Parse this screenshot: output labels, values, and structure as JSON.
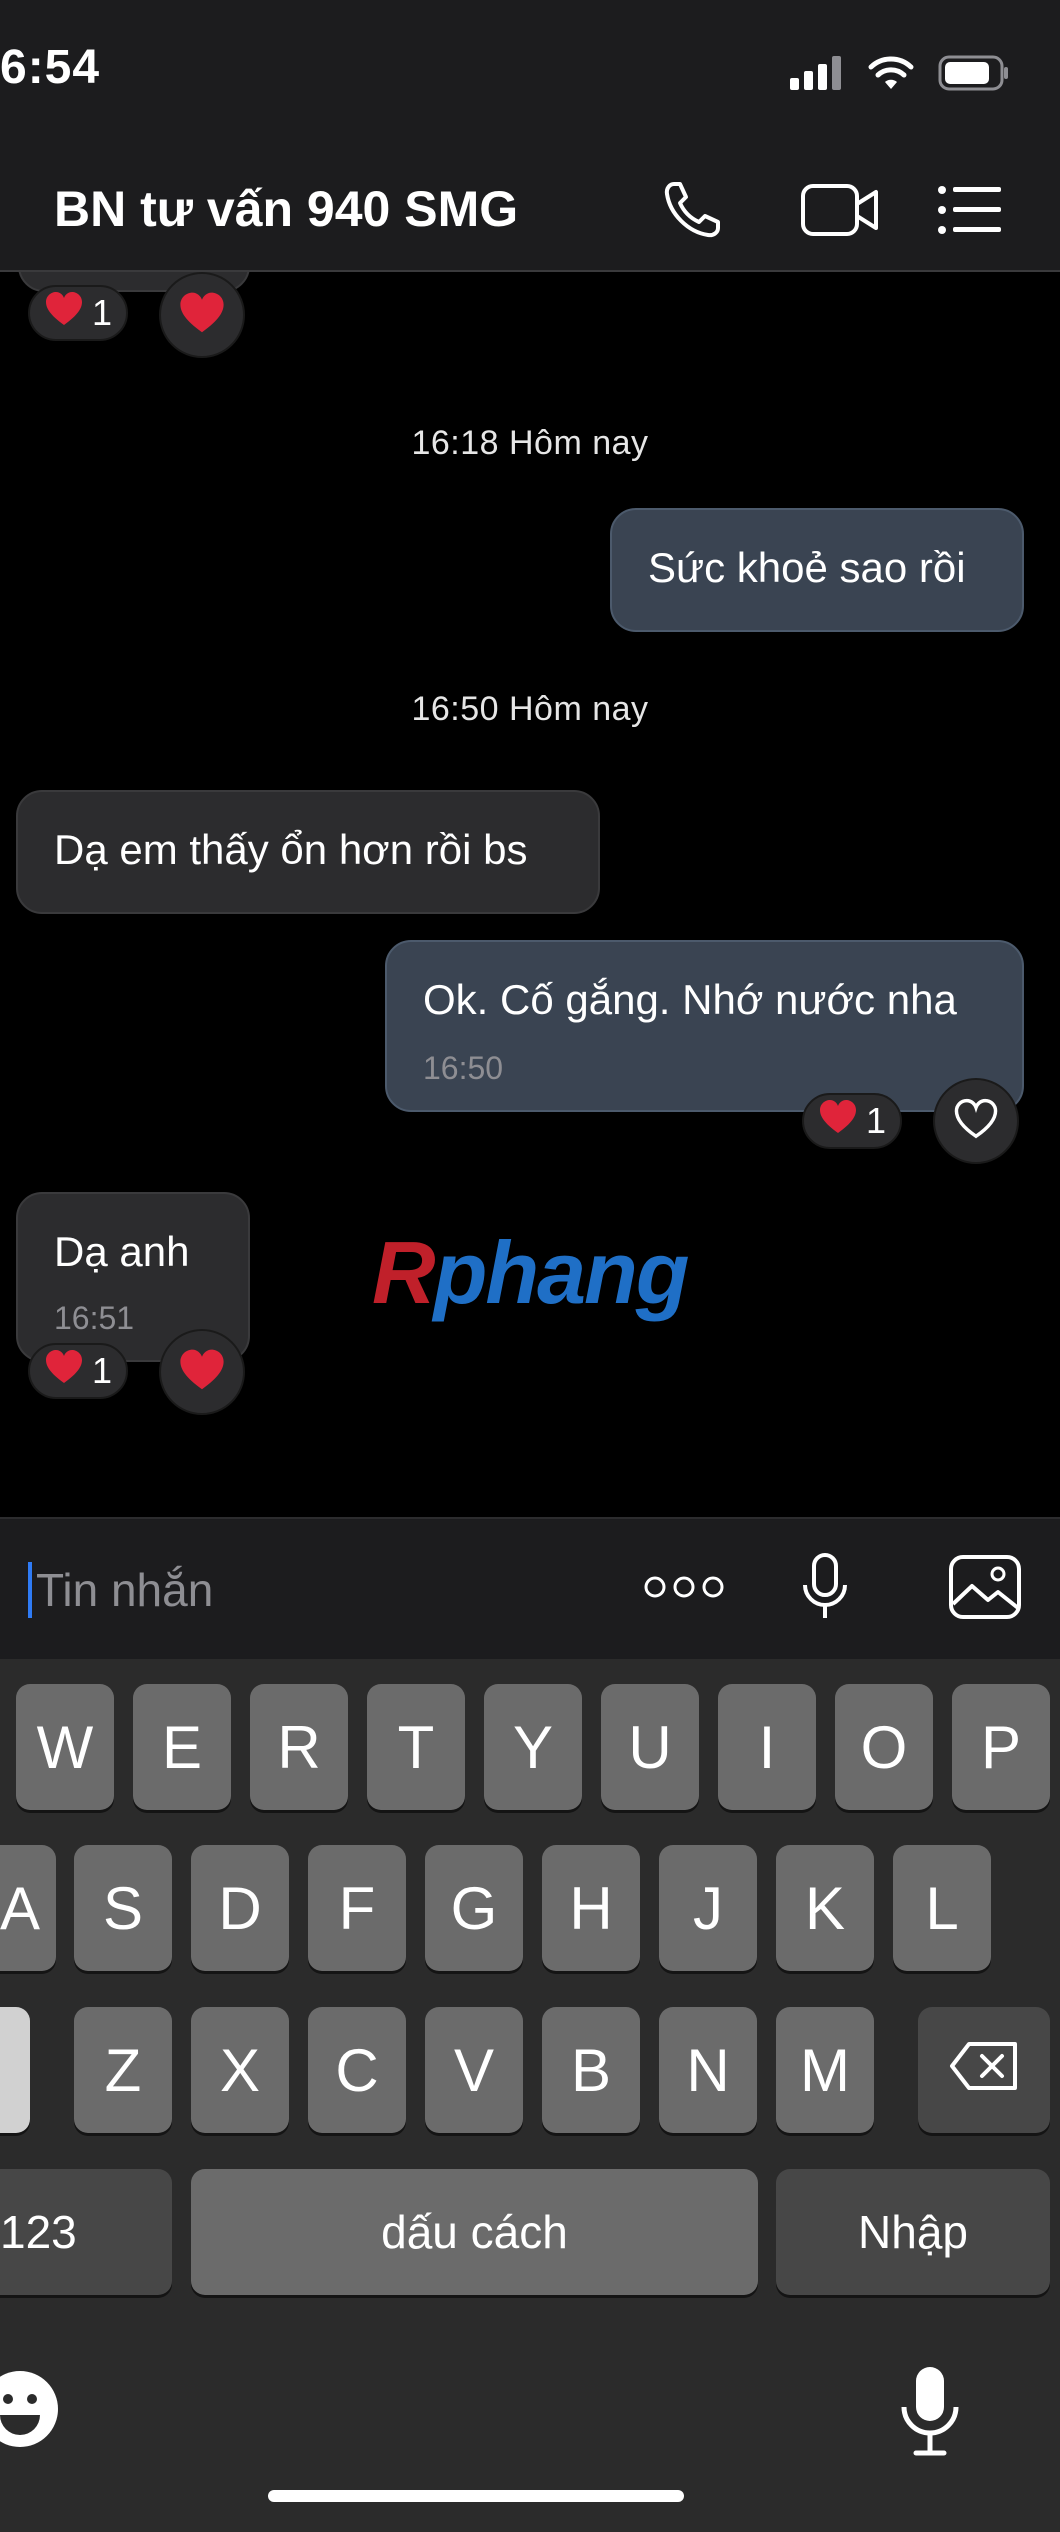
{
  "status_bar": {
    "time": "6:54"
  },
  "header": {
    "title": "BN tư vấn 940 SMG",
    "icons": [
      "phone-icon",
      "video-icon",
      "menu-list-icon"
    ]
  },
  "messages": {
    "top_reaction_count": "1",
    "separator_1": "16:18 Hôm nay",
    "msg_out_1": {
      "text": "Sức khoẻ sao rồi"
    },
    "separator_2": "16:50 Hôm nay",
    "msg_in_1": {
      "text": "Dạ em thấy ổn hơn rồi bs"
    },
    "msg_out_2": {
      "text": "Ok. Cố gắng. Nhớ nước nha",
      "time": "16:50",
      "reaction_count": "1"
    },
    "msg_in_2": {
      "text": "Dạ anh",
      "time": "16:51",
      "reaction_count": "1"
    }
  },
  "watermark": {
    "part1": "R",
    "part2": "phang"
  },
  "composer": {
    "placeholder": "Tin nhắn"
  },
  "keyboard": {
    "row1": [
      "W",
      "E",
      "R",
      "T",
      "Y",
      "U",
      "I",
      "O",
      "P"
    ],
    "row2": [
      "A",
      "S",
      "D",
      "F",
      "G",
      "H",
      "J",
      "K",
      "L"
    ],
    "row3": [
      "Z",
      "X",
      "C",
      "V",
      "B",
      "N",
      "M"
    ],
    "numbers_key": "123",
    "space_key": "dấu cách",
    "return_key": "Nhập"
  },
  "colors": {
    "background": "#000000",
    "incoming_bubble": "#2c2c2e",
    "outgoing_bubble": "#3a4452",
    "keyboard_key": "#6b6b6b",
    "heart": "#e0243a"
  }
}
